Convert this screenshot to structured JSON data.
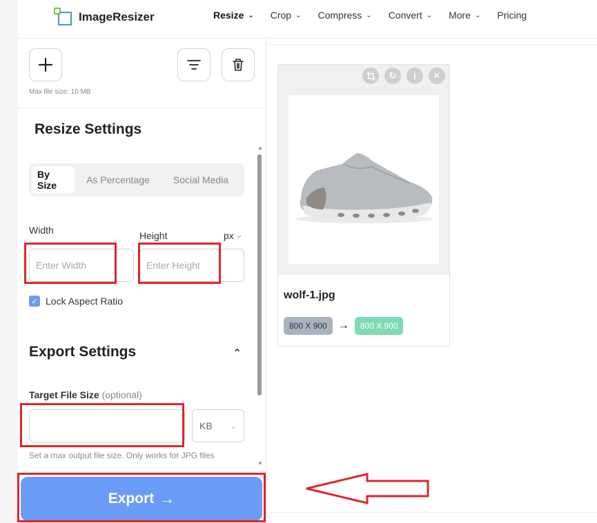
{
  "header": {
    "logo_text": "ImageResizer",
    "nav": [
      {
        "label": "Resize",
        "has_menu": true,
        "active": true
      },
      {
        "label": "Crop",
        "has_menu": true
      },
      {
        "label": "Compress",
        "has_menu": true
      },
      {
        "label": "Convert",
        "has_menu": true
      },
      {
        "label": "More",
        "has_menu": true
      },
      {
        "label": "Pricing",
        "has_menu": false
      }
    ]
  },
  "toolbar": {
    "add_icon": "plus-icon",
    "filter_icon": "filter-icon",
    "trash_icon": "trash-icon",
    "max_file_size": "Max file size: 10 MB"
  },
  "resize": {
    "title": "Resize Settings",
    "tabs": [
      "By Size",
      "As Percentage",
      "Social Media"
    ],
    "active_tab": "By Size",
    "width_label": "Width",
    "height_label": "Height",
    "unit": "px",
    "width_placeholder": "Enter Width",
    "height_placeholder": "Enter Height",
    "lock_label": "Lock Aspect Ratio",
    "lock_checked": true
  },
  "export": {
    "title": "Export Settings",
    "target_label": "Target File Size",
    "target_optional": "(optional)",
    "target_value": "",
    "unit": "KB",
    "hint": "Set a max output file size. Only works for JPG files",
    "button_label": "Export",
    "button_arrow": "→"
  },
  "file_card": {
    "filename": "wolf-1.jpg",
    "original_dims": "800 X 900",
    "new_dims": "800 X 900",
    "icons": [
      "crop-icon",
      "rotate-icon",
      "info-icon",
      "close-icon"
    ]
  },
  "colors": {
    "accent": "#6b9cf5",
    "annotation_red": "#e0242b",
    "badge_new": "#7edbb3",
    "badge_orig": "#a9b3be"
  }
}
